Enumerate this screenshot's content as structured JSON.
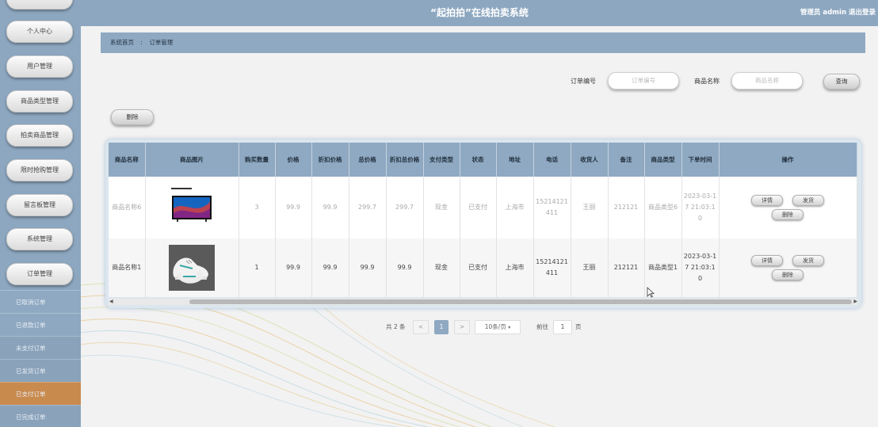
{
  "header": {
    "title": "“起拍拍”在线拍卖系统",
    "user": "管理员 admin",
    "logout": "退出登录"
  },
  "sidebar": {
    "items": [
      {
        "label": ""
      },
      {
        "label": "个人中心"
      },
      {
        "label": "用户管理"
      },
      {
        "label": "商品类型管理"
      },
      {
        "label": "拍卖商品管理"
      },
      {
        "label": "限时抢购管理"
      },
      {
        "label": "留言板管理"
      },
      {
        "label": "系统管理"
      },
      {
        "label": "订单管理"
      }
    ],
    "sub_items": [
      {
        "label": "已取消订单"
      },
      {
        "label": "已退款订单"
      },
      {
        "label": "未支付订单"
      },
      {
        "label": "已发货订单"
      },
      {
        "label": "已支付订单"
      },
      {
        "label": "已完成订单"
      }
    ]
  },
  "breadcrumb": {
    "home": "系统首页",
    "sep": ":",
    "current": "订单管理"
  },
  "search": {
    "order_no_label": "订单编号",
    "order_no_placeholder": "订单编号",
    "product_name_label": "商品名称",
    "product_name_placeholder": "商品名称",
    "query_button": "查询"
  },
  "toolbar": {
    "delete_button": "删除"
  },
  "table": {
    "headers": [
      "商品名称",
      "商品图片",
      "购买数量",
      "价格",
      "折扣价格",
      "总价格",
      "折扣总价格",
      "支付类型",
      "状态",
      "地址",
      "电话",
      "收货人",
      "备注",
      "商品类型",
      "下单时间",
      "操作"
    ],
    "rows": [
      {
        "name": "商品名称6",
        "image": "tv-image",
        "qty": "3",
        "price": "99.9",
        "discount_price": "99.9",
        "total": "299.7",
        "discount_total": "299.7",
        "pay_type": "现金",
        "status": "已支付",
        "address": "上海市",
        "phone": "15214121411",
        "receiver": "王丽",
        "remark": "212121",
        "category": "商品类型6",
        "time": "2023-03-17 21:03:10"
      },
      {
        "name": "商品名称1",
        "image": "shoe-image",
        "qty": "1",
        "price": "99.9",
        "discount_price": "99.9",
        "total": "99.9",
        "discount_total": "99.9",
        "pay_type": "现金",
        "status": "已支付",
        "address": "上海市",
        "phone": "15214121411",
        "receiver": "王丽",
        "remark": "212121",
        "category": "商品类型1",
        "time": "2023-03-17 21:03:10"
      }
    ],
    "actions": {
      "detail": "详情",
      "ship": "发货",
      "delete": "删除"
    }
  },
  "pagination": {
    "total": "共 2 条",
    "prev": "<",
    "page": "1",
    "next": ">",
    "page_size": "10条/页",
    "goto_label": "前往",
    "goto_value": "1",
    "page_suffix": "页"
  },
  "colors": {
    "header": "#8da7c0",
    "table_head": "#8fa9c2",
    "active_sub": "#c98a4e"
  }
}
